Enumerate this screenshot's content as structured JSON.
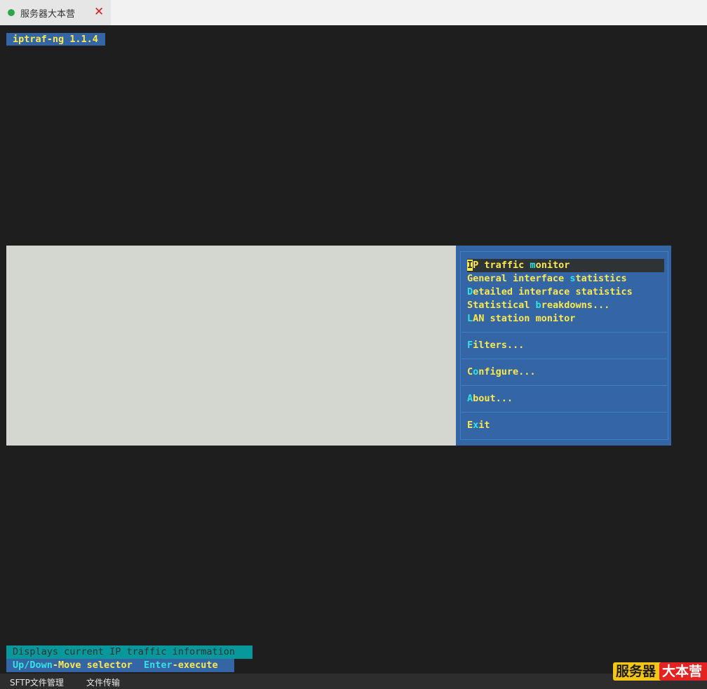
{
  "tab": {
    "title": "服务器大本营",
    "status_color": "#2aa84a",
    "close_glyph": "✕"
  },
  "terminal": {
    "title": "iptraf-ng 1.1.4",
    "menu": {
      "items": [
        {
          "hotkey": "I",
          "rest": "P traffic ",
          "hk2": "m",
          "rest2": "onitor",
          "selected": true
        },
        {
          "pre": "General interface ",
          "hotkey": "s",
          "rest": "tatistics"
        },
        {
          "hotkey": "D",
          "rest": "etailed interface statistics"
        },
        {
          "pre": "Statistical ",
          "hotkey": "b",
          "rest": "reakdowns..."
        },
        {
          "hotkey": "L",
          "rest": "AN station monitor"
        },
        {
          "hotkey": "F",
          "rest": "ilters..."
        },
        {
          "pre": "C",
          "hotkey": "o",
          "rest": "nfigure..."
        },
        {
          "hotkey": "A",
          "rest": "bout..."
        },
        {
          "pre": "E",
          "hotkey": "x",
          "rest": "it"
        }
      ]
    },
    "status_info": "Displays current IP traffic information",
    "status_keys": {
      "k1": "Up/Down",
      "t1": "-Move selector  ",
      "k2": "Enter",
      "t2": "-execute"
    }
  },
  "bottom": {
    "sftp": "SFTP文件管理",
    "transfer": "文件传输"
  },
  "brand": {
    "part1": "服务器",
    "part2": "大本营"
  },
  "colors": {
    "terminal_bg": "#1e1e1e",
    "menu_bg": "#3465a4",
    "panel_gray": "#d3d7cf",
    "highlight_yellow": "#fce94f",
    "hotkey_cyan": "#34e2e2"
  }
}
